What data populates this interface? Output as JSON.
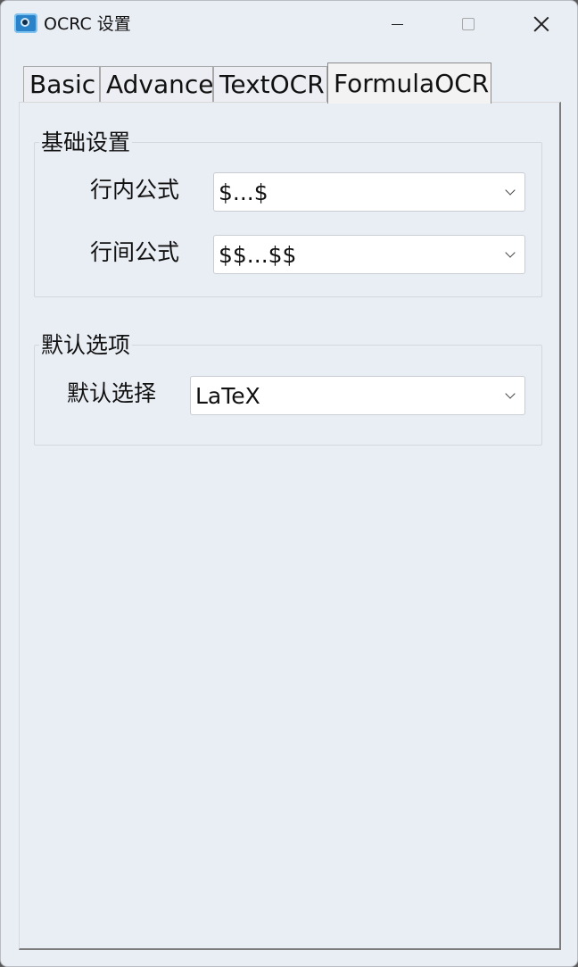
{
  "window": {
    "title": "OCRC 设置",
    "icon": "camera-app-icon"
  },
  "tabs": [
    {
      "label": "Basic",
      "active": false
    },
    {
      "label": "Advance",
      "active": false
    },
    {
      "label": "TextOCR",
      "active": false
    },
    {
      "label": "FormulaOCR",
      "active": true
    }
  ],
  "basic_settings": {
    "title": "基础设置",
    "inline_formula": {
      "label": "行内公式",
      "value": "$...$"
    },
    "display_formula": {
      "label": "行间公式",
      "value": "$$...$$"
    }
  },
  "default_options": {
    "title": "默认选项",
    "default_choice": {
      "label": "默认选择",
      "value": "LaTeX"
    }
  }
}
